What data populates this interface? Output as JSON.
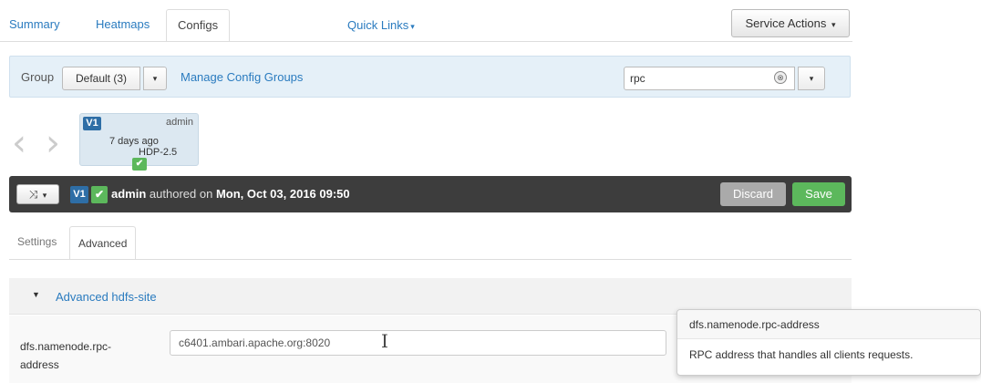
{
  "tabs": [
    {
      "label": "Summary"
    },
    {
      "label": "Heatmaps"
    },
    {
      "label": "Configs"
    }
  ],
  "quick_links": {
    "label": "Quick Links",
    "caret": "▾"
  },
  "service_actions": {
    "label": "Service Actions",
    "caret": "▾"
  },
  "group_bar": {
    "group_label": "Group",
    "group_value": "Default (3)",
    "caret": "▾",
    "manage_link": "Manage Config Groups",
    "search_value": "rpc",
    "clear_icon": "⊗",
    "filter_caret": "▾"
  },
  "version_card": {
    "badge": "V1",
    "user": "admin",
    "time": "7 days ago",
    "stack": "HDP-2.5",
    "check": "✔"
  },
  "nav_icons": {
    "prev": "‹",
    "next": "›"
  },
  "version_bar": {
    "compare_icon": "⤨",
    "compare_caret": "▾",
    "badge": "V1",
    "check": "✔",
    "author": "admin",
    "authored_text": "authored on",
    "date": "Mon, Oct 03, 2016 09:50",
    "discard_label": "Discard",
    "save_label": "Save"
  },
  "sub_tabs": [
    {
      "label": "Settings"
    },
    {
      "label": "Advanced"
    }
  ],
  "section": {
    "toggle": "▼",
    "title": "Advanced hdfs-site"
  },
  "property": {
    "label": "dfs.namenode.rpc-address",
    "value": "c6401.ambari.apache.org:8020",
    "cursor": "I"
  },
  "popover": {
    "title": "dfs.namenode.rpc-address",
    "body": "RPC address that handles all clients requests."
  }
}
